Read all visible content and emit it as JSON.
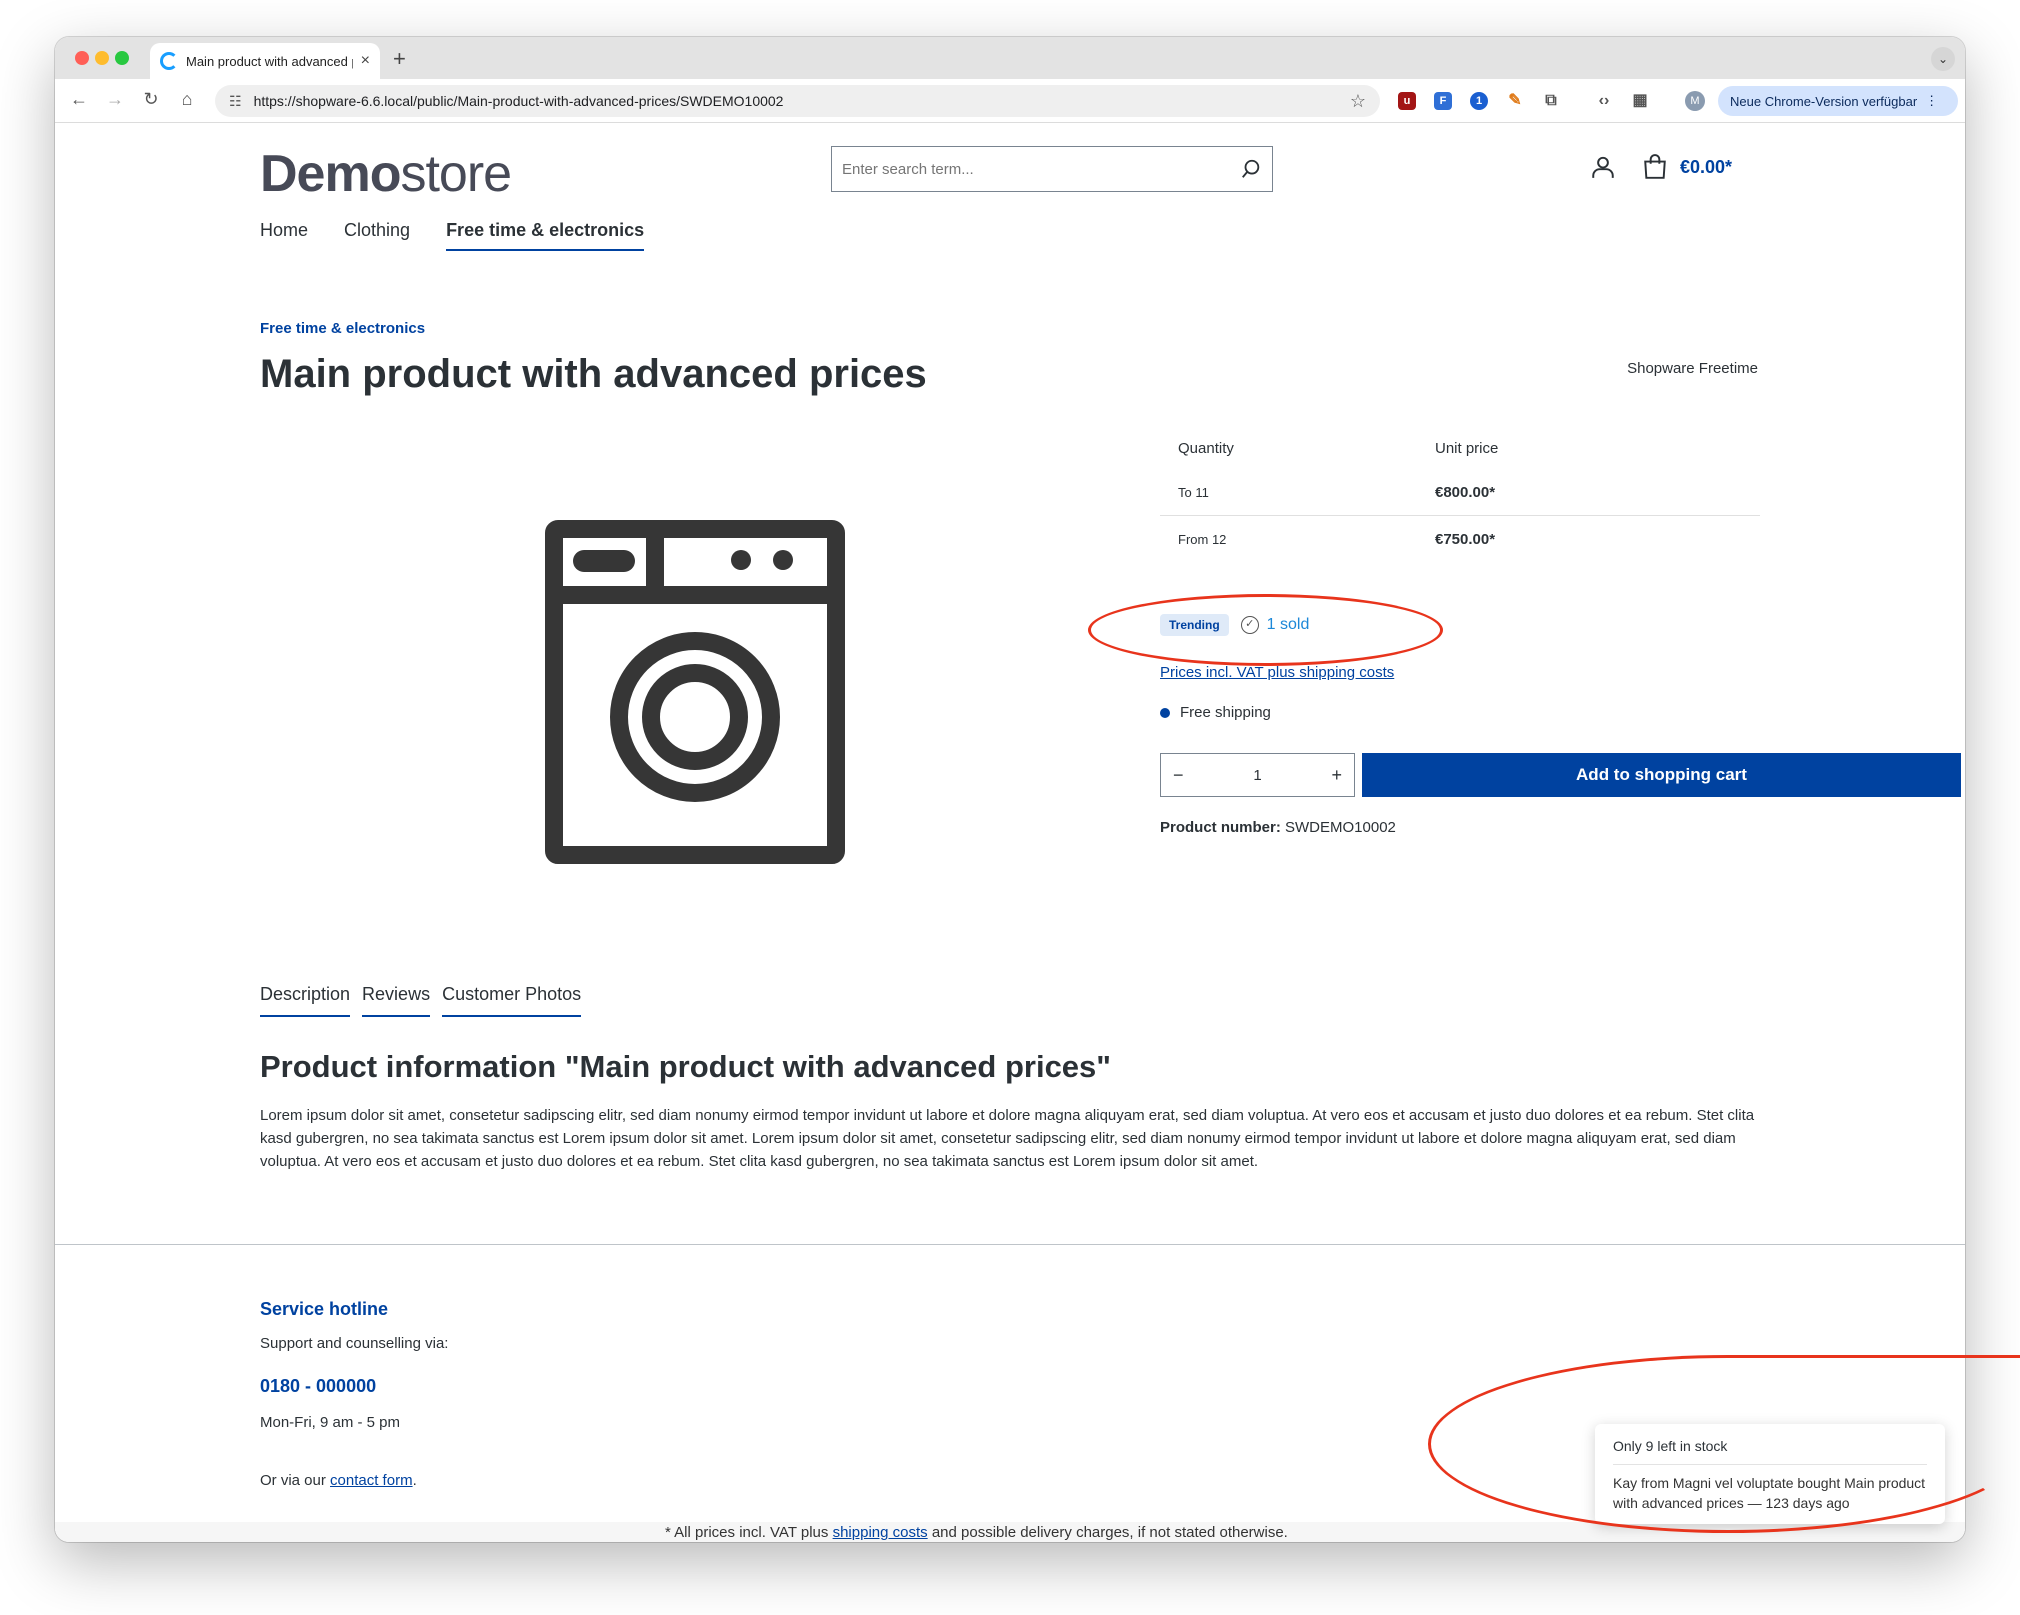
{
  "browser": {
    "tab_title": "Main product with advanced p",
    "url": "https://shopware-6.6.local/public/Main-product-with-advanced-prices/SWDEMO10002",
    "update_label": "Neue Chrome-Version verfügbar",
    "profile_initial": "M"
  },
  "header": {
    "logo_bold": "Demo",
    "logo_light": "store",
    "search_placeholder": "Enter search term...",
    "cart_total": "€0.00*"
  },
  "nav": {
    "items": [
      "Home",
      "Clothing",
      "Free time & electronics"
    ],
    "active": "Free time & electronics"
  },
  "product": {
    "breadcrumb": "Free time & electronics",
    "title": "Main product with advanced prices",
    "manufacturer": "Shopware Freetime",
    "price_table": {
      "headers": [
        "Quantity",
        "Unit price"
      ],
      "rows": [
        {
          "qty": "To 11",
          "price": "€800.00*"
        },
        {
          "qty": "From 12",
          "price": "€750.00*"
        }
      ]
    },
    "badge": "Trending",
    "sold": "1 sold",
    "vat_link": "Prices incl. VAT plus shipping costs",
    "free_shipping": "Free shipping",
    "quantity": "1",
    "add_to_cart": "Add to shopping cart",
    "number_label": "Product number:",
    "number_value": "SWDEMO10002",
    "image_icon": "washing-machine-icon"
  },
  "detail_tabs": [
    "Description",
    "Reviews",
    "Customer Photos"
  ],
  "description": {
    "title": "Product information \"Main product with advanced prices\"",
    "text": "Lorem ipsum dolor sit amet, consetetur sadipscing elitr, sed diam nonumy eirmod tempor invidunt ut labore et dolore magna aliquyam erat, sed diam voluptua. At vero eos et accusam et justo duo dolores et ea rebum. Stet clita kasd gubergren, no sea takimata sanctus est Lorem ipsum dolor sit amet. Lorem ipsum dolor sit amet, consetetur sadipscing elitr, sed diam nonumy eirmod tempor invidunt ut labore et dolore magna aliquyam erat, sed diam voluptua. At vero eos et accusam et justo duo dolores et ea rebum. Stet clita kasd gubergren, no sea takimata sanctus est Lorem ipsum dolor sit amet."
  },
  "footer": {
    "hotline_title": "Service hotline",
    "hotline_sub": "Support and counselling via:",
    "hotline_number": "0180 - 000000",
    "hotline_hours": "Mon-Fri, 9 am - 5 pm",
    "contact_prefix": "Or via our",
    "contact_link": "contact form",
    "contact_suffix": ".",
    "note_prefix": "* All prices incl. VAT plus",
    "note_link": "shipping costs",
    "note_suffix": "and possible delivery charges, if not stated otherwise."
  },
  "toast": {
    "heading": "Only 9 left in stock",
    "body": "Kay from Magni vel voluptate bought Main product with advanced prices — 123 days ago"
  },
  "colors": {
    "brand": "#0042a0",
    "annotation": "#e8341c",
    "sold_text": "#1d88d8"
  }
}
